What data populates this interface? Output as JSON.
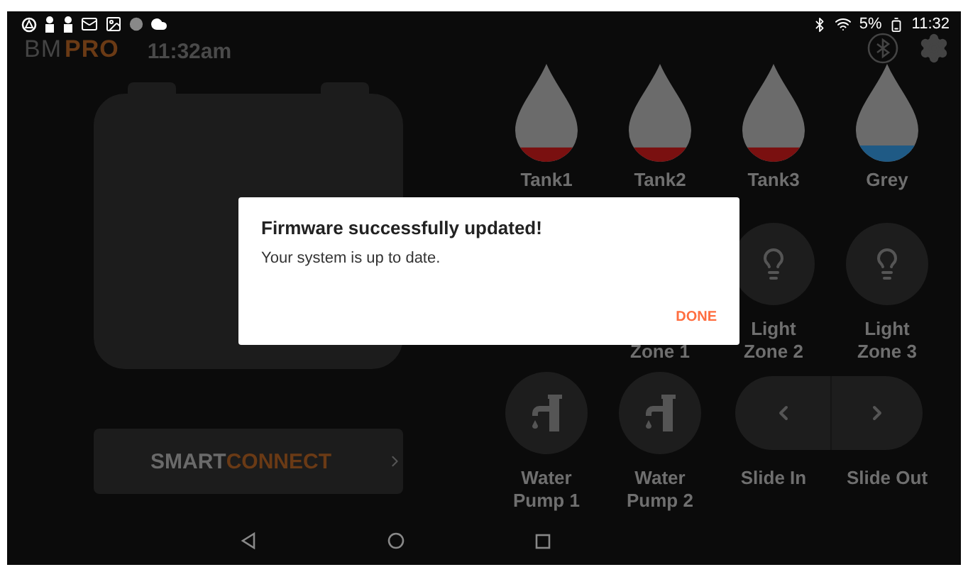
{
  "status_bar": {
    "battery_text": "5%",
    "time": "11:32"
  },
  "header": {
    "logo_a": "BM",
    "logo_b": "PRO",
    "clock": "11:32am"
  },
  "tanks": [
    {
      "label": "Tank1",
      "level": 0.16,
      "color": "#7a1010"
    },
    {
      "label": "Tank2",
      "level": 0.16,
      "color": "#7a1010"
    },
    {
      "label": "Tank3",
      "level": 0.16,
      "color": "#7a1010"
    },
    {
      "label": "Grey",
      "level": 0.18,
      "color": "#1f5a85"
    }
  ],
  "controls": [
    {
      "kind": "light",
      "lines": [
        "Zone 1"
      ]
    },
    {
      "kind": "light",
      "lines": [
        "Light",
        "Zone 2"
      ]
    },
    {
      "kind": "light",
      "lines": [
        "Light",
        "Zone 3"
      ]
    },
    {
      "kind": "pump",
      "lines": [
        "Water",
        "Pump 1"
      ]
    },
    {
      "kind": "pump",
      "lines": [
        "Water",
        "Pump 2"
      ]
    },
    {
      "kind": "slide",
      "lines": [
        "Slide In"
      ]
    },
    {
      "kind": "slide",
      "lines": [
        "Slide Out"
      ]
    }
  ],
  "smart_connect": {
    "part_a": "SMART",
    "part_b": "CONNECT"
  },
  "dialog": {
    "title": "Firmware successfully updated!",
    "message": "Your system is up to date.",
    "button": "DONE"
  }
}
